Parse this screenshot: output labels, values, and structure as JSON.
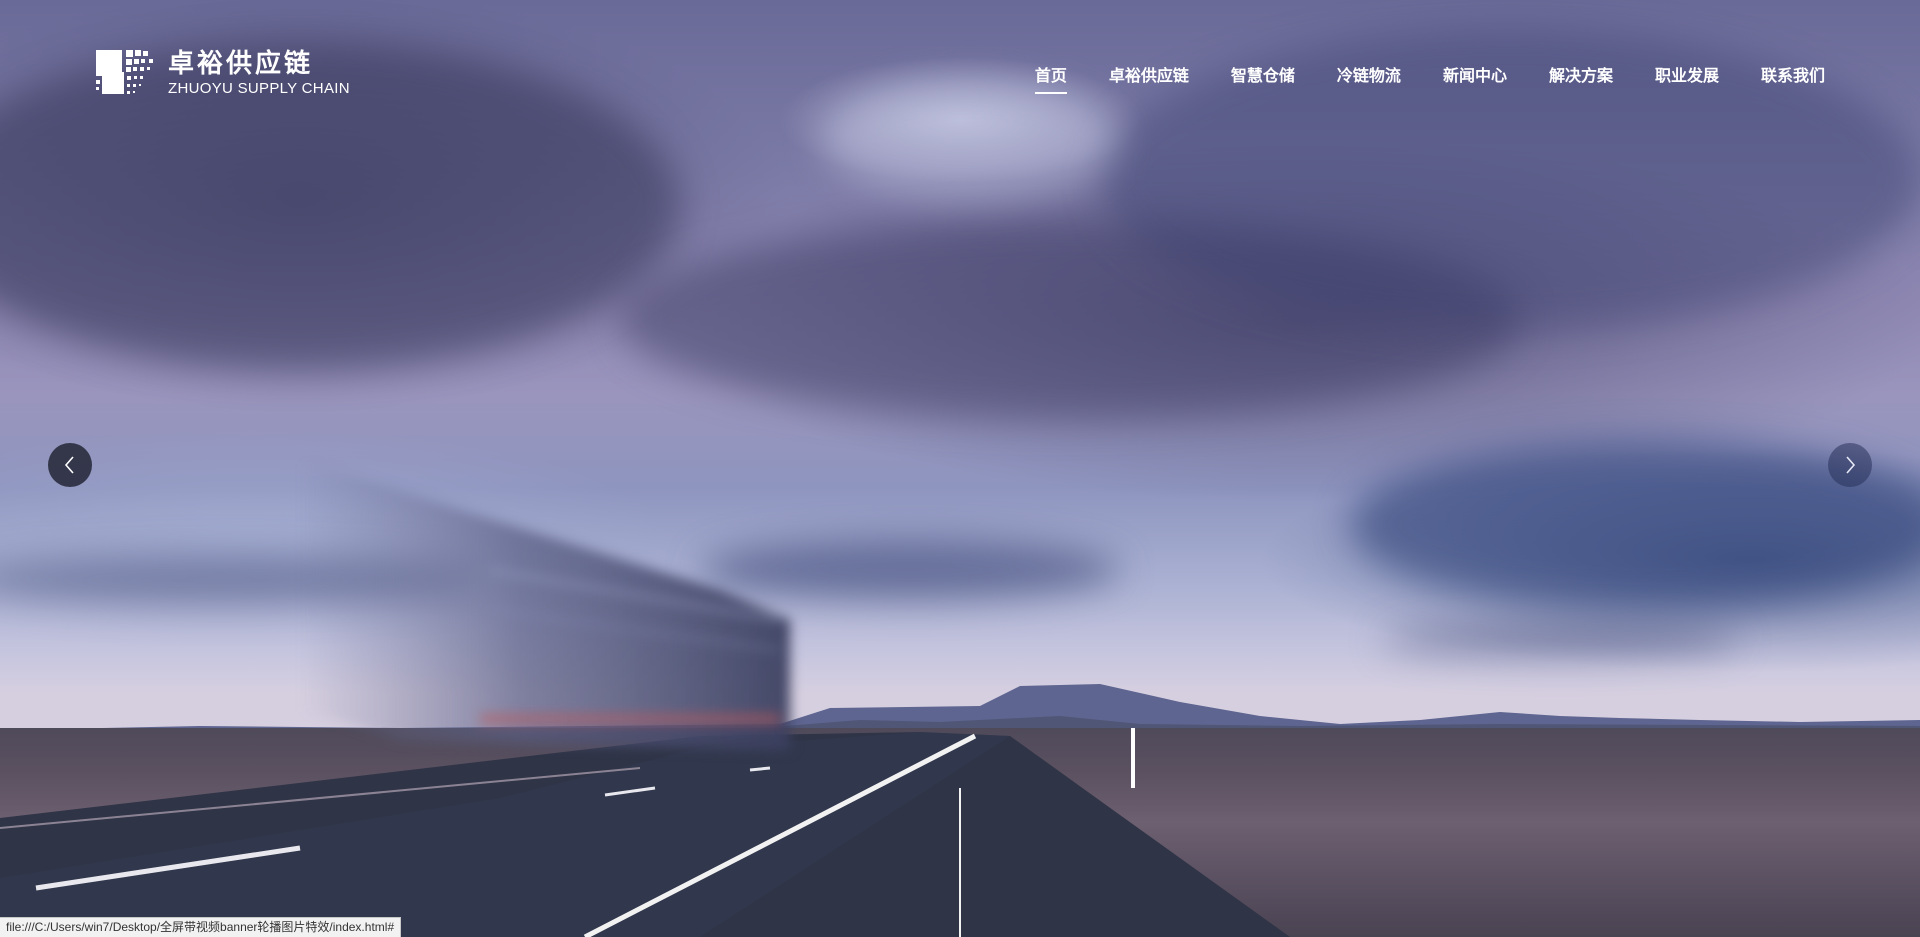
{
  "logo": {
    "name_cn": "卓裕供应链",
    "name_en": "ZHUOYU SUPPLY CHAIN",
    "icon": "zhuoyu-logo-mark"
  },
  "nav": {
    "items": [
      {
        "label": "首页",
        "active": true
      },
      {
        "label": "卓裕供应链",
        "active": false
      },
      {
        "label": "智慧仓储",
        "active": false
      },
      {
        "label": "冷链物流",
        "active": false
      },
      {
        "label": "新闻中心",
        "active": false
      },
      {
        "label": "解决方案",
        "active": false
      },
      {
        "label": "职业发展",
        "active": false
      },
      {
        "label": "联系我们",
        "active": false
      }
    ]
  },
  "carousel": {
    "prev_icon": "chevron-left-icon",
    "next_icon": "chevron-right-icon"
  },
  "statusbar": {
    "url": "file:///C:/Users/win7/Desktop/全屏带视频banner轮播图片特效/index.html#"
  },
  "colors": {
    "nav_text": "#ffffff",
    "arrow_bg": "#14162380"
  }
}
